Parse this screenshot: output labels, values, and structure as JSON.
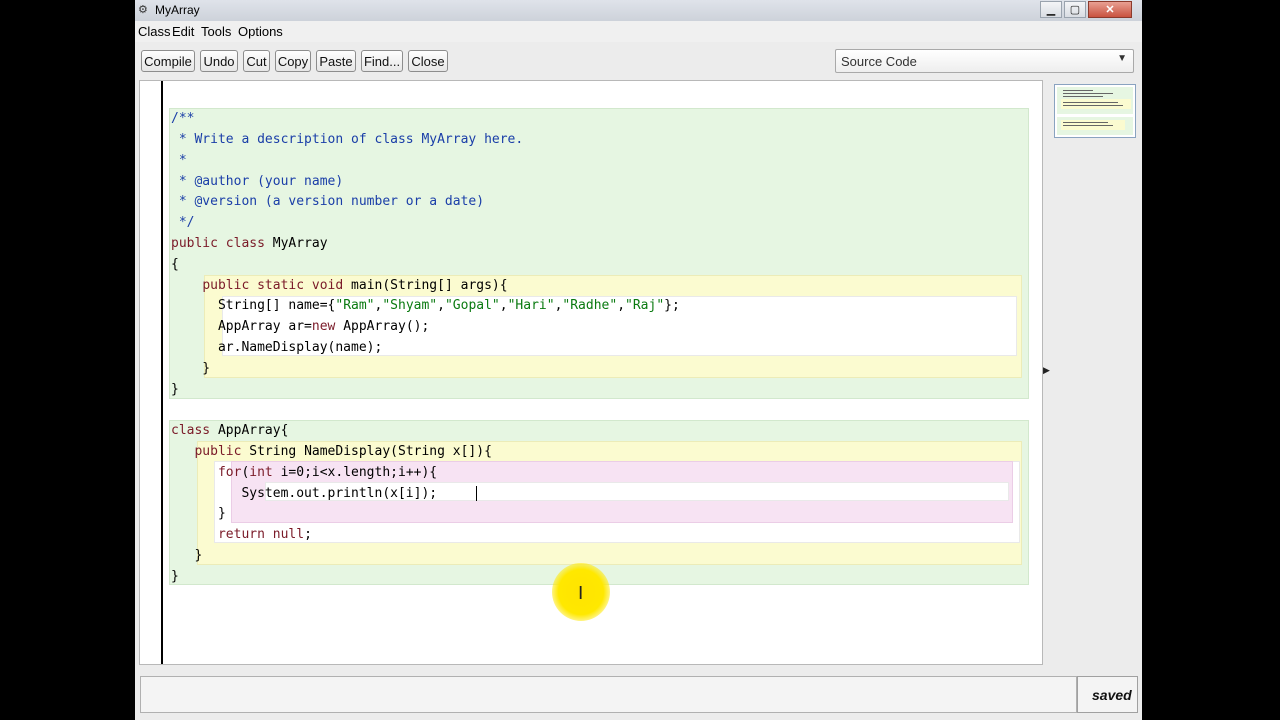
{
  "window": {
    "title": "MyArray",
    "controls": {
      "minimize": "▁",
      "maximize": "▢",
      "close": "✕"
    }
  },
  "menu": [
    "Class",
    "Edit",
    "Tools",
    "Options"
  ],
  "toolbar": [
    "Compile",
    "Undo",
    "Cut",
    "Copy",
    "Paste",
    "Find...",
    "Close"
  ],
  "view_selector": {
    "selected": "Source Code"
  },
  "editor": {
    "lines": [
      "/**",
      " * Write a description of class MyArray here.",
      " *",
      " * @author (your name)",
      " * @version (a version number or a date)",
      " */",
      "public class MyArray",
      "{",
      "    public static void main(String[] args){",
      "      String[] name={\"Ram\",\"Shyam\",\"Gopal\",\"Hari\",\"Radhe\",\"Raj\"};",
      "      AppArray ar=new AppArray();",
      "      ar.NameDisplay(name);",
      "    }",
      "}",
      "class AppArray{",
      "   public String NameDisplay(String x[]){",
      "      for(int i=0;i<x.length;i++){",
      "         System.out.println(x[i]);",
      "      }",
      "      return null;",
      "   }",
      "}"
    ]
  },
  "status": {
    "message": "",
    "saved_label": "saved"
  },
  "colors": {
    "class_scope": "#e6f6e2",
    "method_scope": "#fbfbd0",
    "loop_scope": "#f7e3f3",
    "comment": "#1a3ea8",
    "keyword": "#7a1a28",
    "string": "#0a7a10",
    "cursor_highlight": "#ffe400"
  }
}
